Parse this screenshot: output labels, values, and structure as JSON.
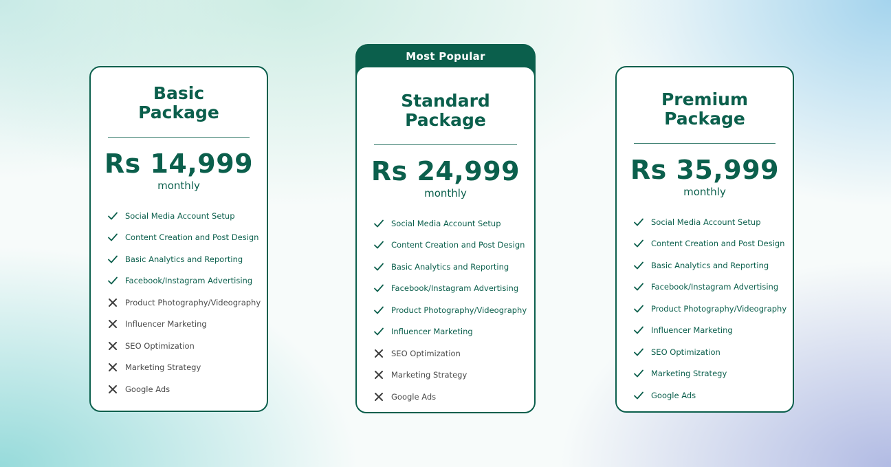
{
  "colors": {
    "brand": "#0b5f4c",
    "excluded_text": "#4a4a4a",
    "card_bg": "#ffffff"
  },
  "plans": [
    {
      "title_line1": "Basic",
      "title_line2": "Package",
      "price": "Rs 14,999",
      "period": "monthly",
      "features": [
        {
          "label": "Social Media Account Setup",
          "included": true
        },
        {
          "label": "Content Creation and Post Design",
          "included": true
        },
        {
          "label": "Basic Analytics and Reporting",
          "included": true
        },
        {
          "label": "Facebook/Instagram Advertising",
          "included": true
        },
        {
          "label": "Product Photography/Videography",
          "included": false
        },
        {
          "label": "Influencer Marketing",
          "included": false
        },
        {
          "label": "SEO Optimization",
          "included": false
        },
        {
          "label": "Marketing Strategy",
          "included": false
        },
        {
          "label": "Google Ads",
          "included": false
        }
      ]
    },
    {
      "badge": "Most Popular",
      "title_line1": "Standard",
      "title_line2": "Package",
      "price": "Rs 24,999",
      "period": "monthly",
      "features": [
        {
          "label": "Social Media Account Setup",
          "included": true
        },
        {
          "label": "Content Creation and Post Design",
          "included": true
        },
        {
          "label": "Basic Analytics and Reporting",
          "included": true
        },
        {
          "label": "Facebook/Instagram Advertising",
          "included": true
        },
        {
          "label": "Product Photography/Videography",
          "included": true
        },
        {
          "label": "Influencer Marketing",
          "included": true
        },
        {
          "label": "SEO Optimization",
          "included": false
        },
        {
          "label": "Marketing Strategy",
          "included": false
        },
        {
          "label": "Google Ads",
          "included": false
        }
      ]
    },
    {
      "title_line1": "Premium",
      "title_line2": "Package",
      "price": "Rs 35,999",
      "period": "monthly",
      "features": [
        {
          "label": "Social Media Account Setup",
          "included": true
        },
        {
          "label": "Content Creation and Post Design",
          "included": true
        },
        {
          "label": "Basic Analytics and Reporting",
          "included": true
        },
        {
          "label": "Facebook/Instagram Advertising",
          "included": true
        },
        {
          "label": "Product Photography/Videography",
          "included": true
        },
        {
          "label": "Influencer Marketing",
          "included": true
        },
        {
          "label": "SEO Optimization",
          "included": true
        },
        {
          "label": "Marketing Strategy",
          "included": true
        },
        {
          "label": "Google Ads",
          "included": true
        }
      ]
    }
  ]
}
